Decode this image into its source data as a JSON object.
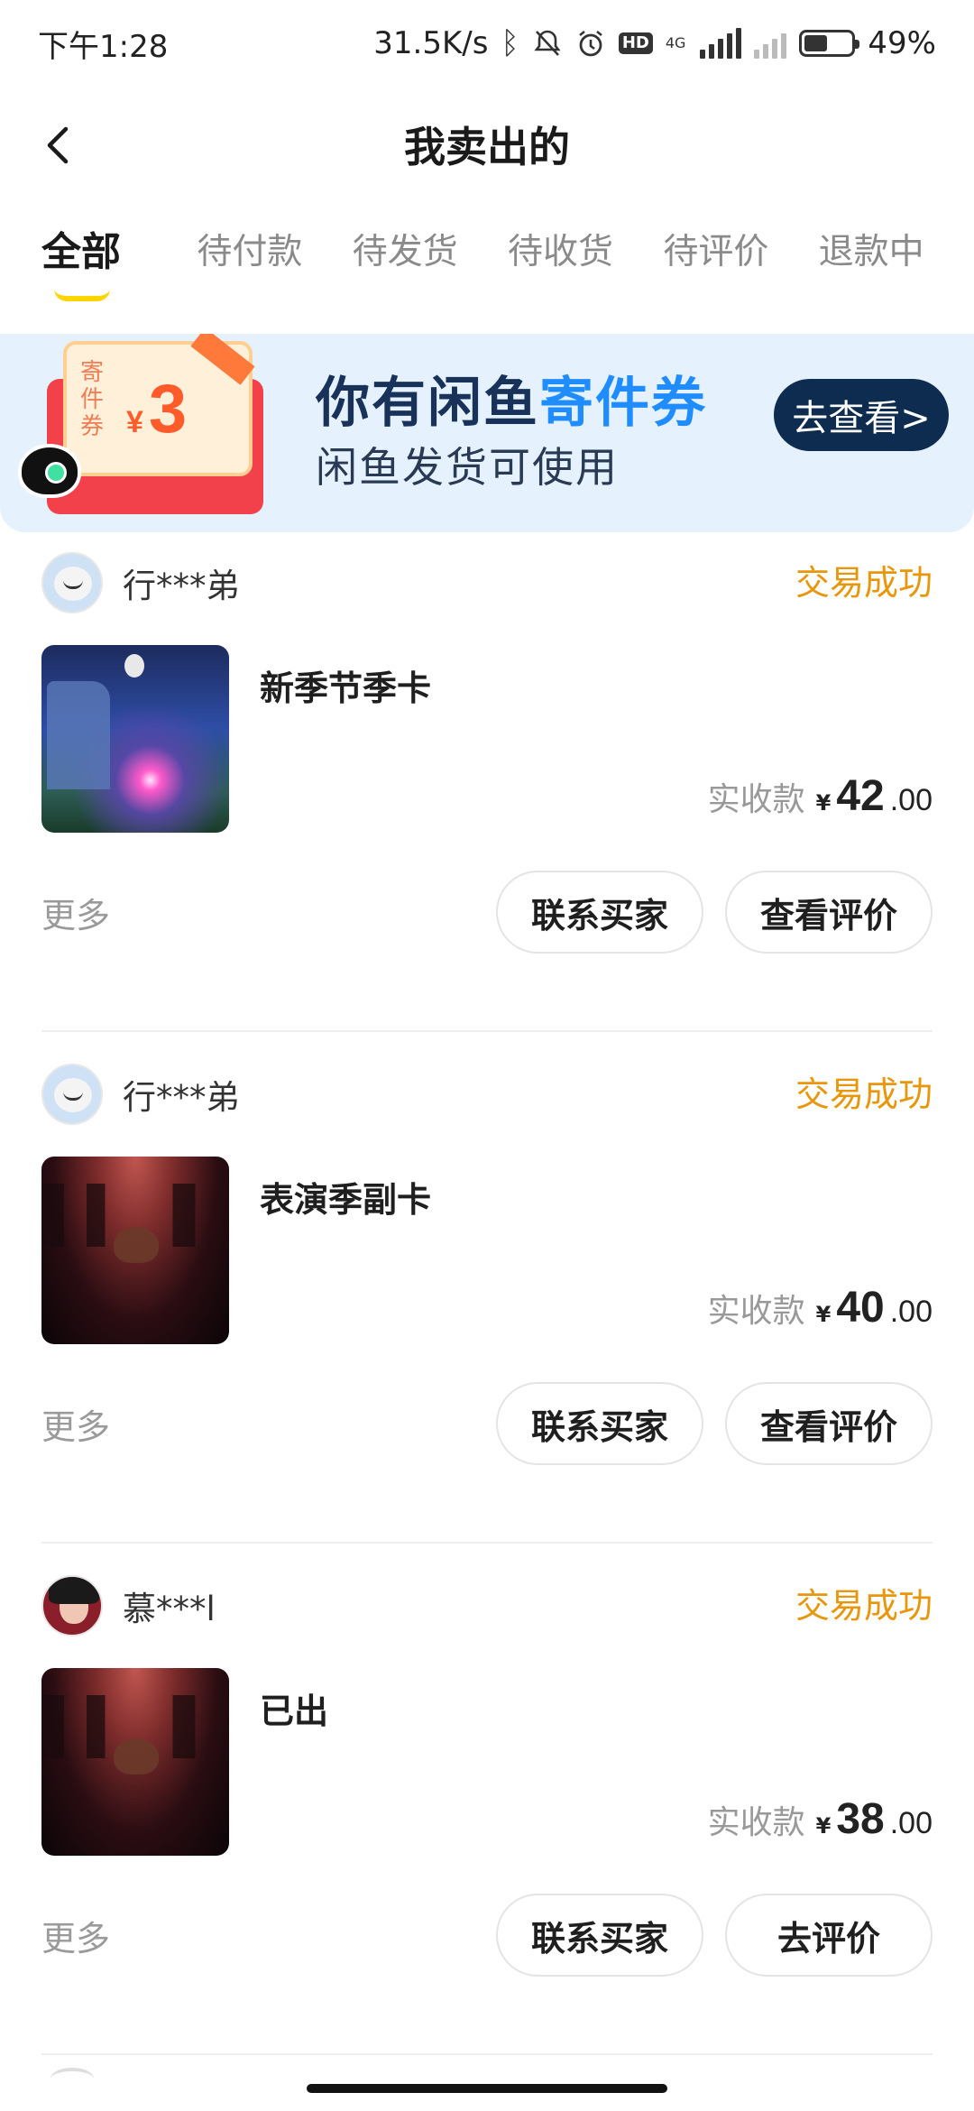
{
  "status_bar": {
    "time": "下午1:28",
    "net_speed": "31.5K/s",
    "net_type": "4G",
    "hd_label": "HD",
    "battery_text": "49%",
    "battery_level": 0.49
  },
  "header": {
    "title": "我卖出的"
  },
  "tabs": [
    {
      "label": "全部",
      "active": true
    },
    {
      "label": "待付款"
    },
    {
      "label": "待发货"
    },
    {
      "label": "待收货"
    },
    {
      "label": "待评价"
    },
    {
      "label": "退款中"
    }
  ],
  "banner": {
    "coupon_label": "寄件券",
    "coupon_yen": "¥",
    "coupon_amount": "3",
    "line1_prefix": "你有闲鱼",
    "line1_accent": "寄件券",
    "line2": "闲鱼发货可使用",
    "button_label": "去查看>"
  },
  "orders": [
    {
      "buyer": "行***弟",
      "status": "交易成功",
      "title": "新季节季卡",
      "price_label": "实收款",
      "price_yen": "¥",
      "price_int": "42",
      "price_dec": ".00",
      "more": "更多",
      "btn1": "联系买家",
      "btn2": "查看评价"
    },
    {
      "buyer": "行***弟",
      "status": "交易成功",
      "title": "表演季副卡",
      "price_label": "实收款",
      "price_yen": "¥",
      "price_int": "40",
      "price_dec": ".00",
      "more": "更多",
      "btn1": "联系买家",
      "btn2": "查看评价"
    },
    {
      "buyer": "慕***l",
      "status": "交易成功",
      "title": "已出",
      "price_label": "实收款",
      "price_yen": "¥",
      "price_int": "38",
      "price_dec": ".00",
      "more": "更多",
      "btn1": "联系买家",
      "btn2": "去评价"
    }
  ],
  "colors": {
    "accent_yellow": "#ffd400",
    "status_orange": "#e8960c",
    "banner_bg": "#e5f2fd",
    "banner_accent": "#1f8cff"
  }
}
